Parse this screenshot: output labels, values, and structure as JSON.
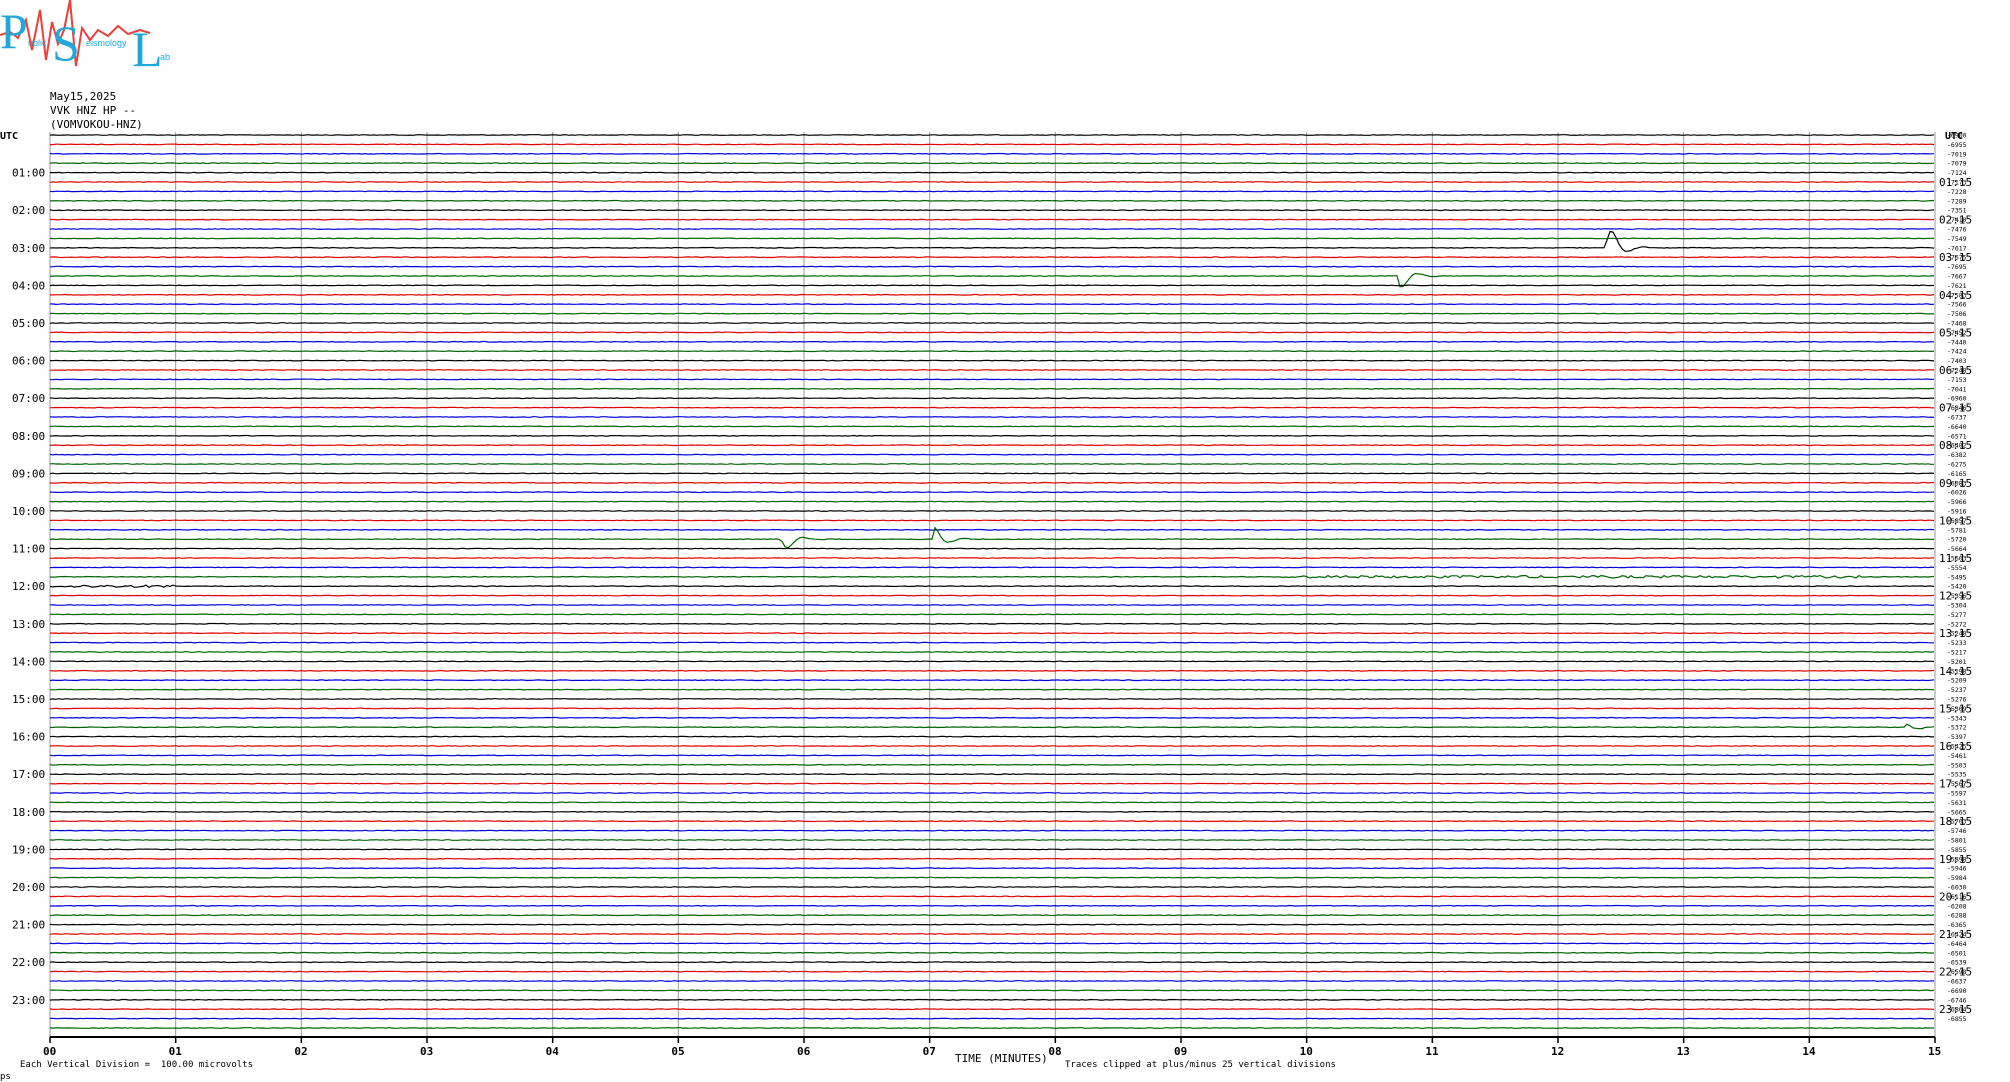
{
  "logo": {
    "big_letters": [
      "P",
      "S",
      "L"
    ],
    "small_text": [
      "ublic",
      "eismology",
      "ab"
    ],
    "colors": {
      "letters": "#22a8d8",
      "wave": "#e8403a"
    }
  },
  "header": {
    "date": "May15,2025",
    "station": "VVK HNZ HP --",
    "site": "(VOMVOKOU-HNZ)"
  },
  "chart_data": {
    "type": "line",
    "title": "",
    "xlabel": "TIME (MINUTES)",
    "ylabel": "",
    "xlim": [
      0,
      15
    ],
    "x_ticks": [
      "00",
      "01",
      "02",
      "03",
      "04",
      "05",
      "06",
      "07",
      "08",
      "09",
      "10",
      "11",
      "12",
      "13",
      "14",
      "15"
    ],
    "left_axis_title": "UTC",
    "right_axis_title": "UTC",
    "left_hour_labels": [
      "01:00",
      "02:00",
      "03:00",
      "04:00",
      "05:00",
      "06:00",
      "07:00",
      "08:00",
      "09:00",
      "10:00",
      "11:00",
      "12:00",
      "13:00",
      "14:00",
      "15:00",
      "16:00",
      "17:00",
      "18:00",
      "19:00",
      "20:00",
      "21:00",
      "22:00",
      "23:00"
    ],
    "right_hour_labels": [
      "01:15",
      "02:15",
      "03:15",
      "04:15",
      "05:15",
      "06:15",
      "07:15",
      "08:15",
      "09:15",
      "10:15",
      "11:15",
      "12:15",
      "13:15",
      "14:15",
      "15:15",
      "16:15",
      "17:15",
      "18:15",
      "19:15",
      "20:15",
      "21:15",
      "22:15",
      "23:15"
    ],
    "trace_count": 96,
    "trace_colors": [
      "#000000",
      "#e00000",
      "#0000e0",
      "#006400"
    ],
    "trace_minutes_each": 15,
    "offsets": [
      "-6900",
      "-6955",
      "-7019",
      "-7079",
      "-7124",
      "-7173",
      "-7228",
      "-7289",
      "-7351",
      "-7410",
      "-7476",
      "-7549",
      "-7617",
      "-7675",
      "-7695",
      "-7667",
      "-7621",
      "-7583",
      "-7566",
      "-7506",
      "-7468",
      "-7452",
      "-7440",
      "-7424",
      "-7403",
      "-7248",
      "-7153",
      "-7041",
      "-6960",
      "-6846",
      "-6737",
      "-6640",
      "-6571",
      "-6482",
      "-6382",
      "-6275",
      "-6165",
      "-6083",
      "-6026",
      "-5966",
      "-5916",
      "-5857",
      "-5781",
      "-5720",
      "-5664",
      "-5603",
      "-5554",
      "-5495",
      "-5420",
      "-5356",
      "-5304",
      "-5277",
      "-5272",
      "-5248",
      "-5233",
      "-5217",
      "-5201",
      "-5198",
      "-5209",
      "-5237",
      "-5276",
      "-5309",
      "-5343",
      "-5372",
      "-5397",
      "-5425",
      "-5461",
      "-5503",
      "-5535",
      "-5567",
      "-5597",
      "-5631",
      "-5665",
      "-5703",
      "-5746",
      "-5801",
      "-5855",
      "-5898",
      "-5946",
      "-5984",
      "-6030",
      "-6116",
      "-6208",
      "-6288",
      "-6365",
      "-6424",
      "-6464",
      "-6501",
      "-6539",
      "-6598",
      "-6637",
      "-6690",
      "-6746",
      "-6804",
      "-6855"
    ],
    "events": [
      {
        "trace_index": 12,
        "minute": 12.4,
        "amplitude": 2.6
      },
      {
        "trace_index": 15,
        "minute": 10.75,
        "amplitude": 1.4
      },
      {
        "trace_index": 43,
        "minute": 5.85,
        "amplitude": 1.2
      },
      {
        "trace_index": 43,
        "minute": 7.05,
        "amplitude": 1.2
      },
      {
        "trace_index": 63,
        "minute": 14.8,
        "amplitude": 0.4
      }
    ],
    "noise_segments": [
      {
        "trace_index": 48,
        "from": 0,
        "to": 1.0,
        "level": 0.35
      },
      {
        "trace_index": 47,
        "from": 9.8,
        "to": 14.4,
        "level": 0.35
      }
    ],
    "grid": true,
    "legend": "none"
  },
  "footer": {
    "division_note": "Each Vertical Division =  100.00 microvolts",
    "clip_note": "Traces clipped at plus/minus 25 vertical divisions",
    "corner_mark": "ps"
  }
}
